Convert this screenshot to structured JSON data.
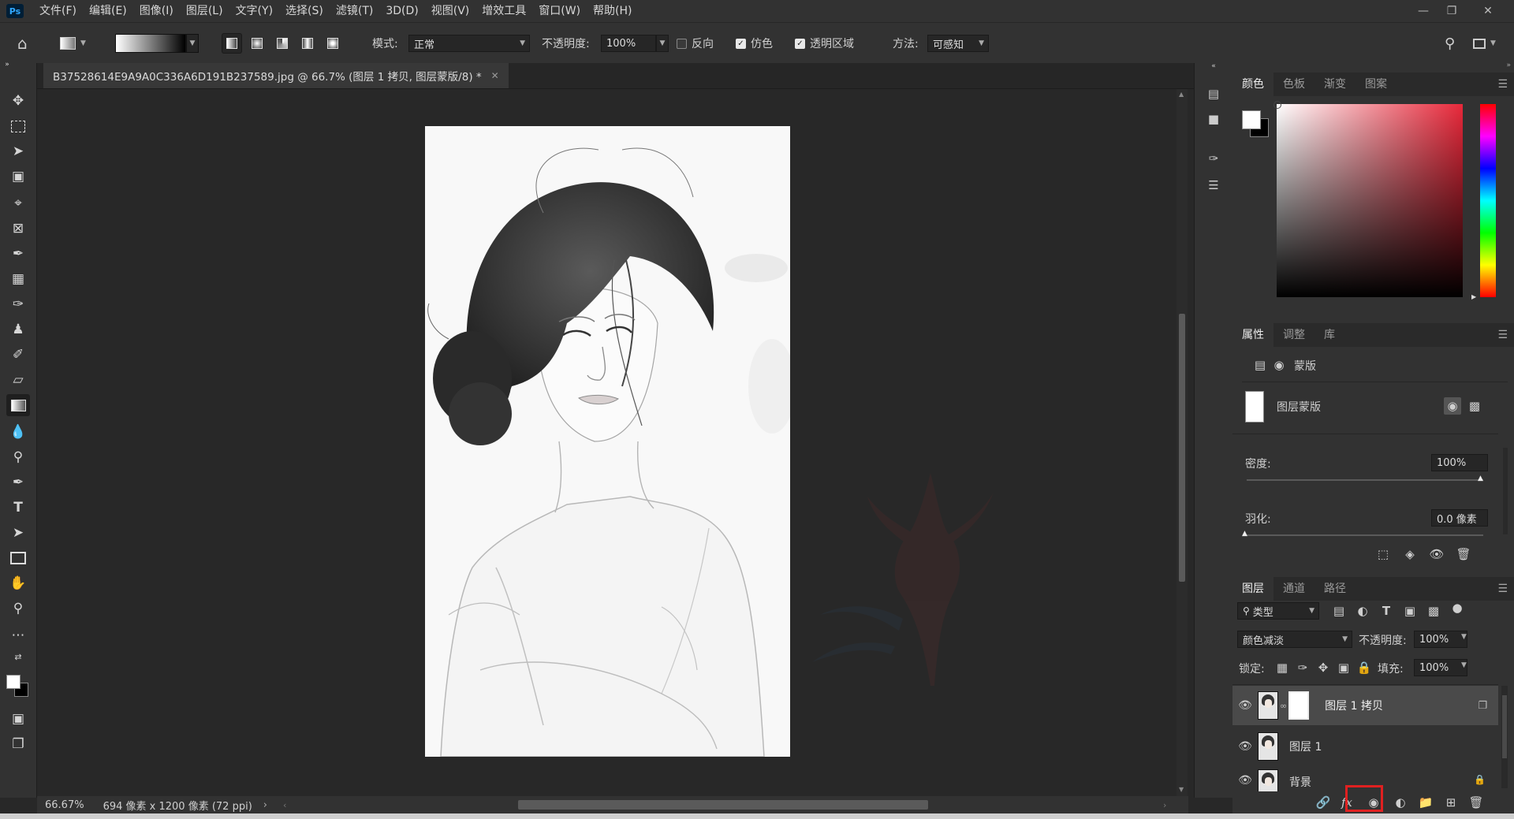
{
  "menubar": {
    "logo": "Ps",
    "items": [
      "文件(F)",
      "编辑(E)",
      "图像(I)",
      "图层(L)",
      "文字(Y)",
      "选择(S)",
      "滤镜(T)",
      "3D(D)",
      "视图(V)",
      "增效工具",
      "窗口(W)",
      "帮助(H)"
    ]
  },
  "options": {
    "mode_label": "模式:",
    "mode_value": "正常",
    "opacity_label": "不透明度:",
    "opacity_value": "100%",
    "reverse_label": "反向",
    "reverse_checked": false,
    "dither_label": "仿色",
    "dither_checked": true,
    "transparency_label": "透明区域",
    "transparency_checked": true,
    "method_label": "方法:",
    "method_value": "可感知"
  },
  "document": {
    "tab_title": "B37528614E9A9A0C336A6D191B237589.jpg @ 66.7% (图层 1 拷贝, 图层蒙版/8) *",
    "zoom": "66.67%",
    "size_info": "694 像素 x 1200 像素 (72 ppi)"
  },
  "color_panel": {
    "tabs": [
      "颜色",
      "色板",
      "渐变",
      "图案"
    ],
    "active_tab": "颜色",
    "hue_color": "#e8283a"
  },
  "properties_panel": {
    "tabs": [
      "属性",
      "调整",
      "库"
    ],
    "active_tab": "属性",
    "mask_section_label": "蒙版",
    "layer_mask_label": "图层蒙版",
    "density_label": "密度:",
    "density_value": "100%",
    "feather_label": "羽化:",
    "feather_value": "0.0 像素"
  },
  "layers_panel": {
    "tabs": [
      "图层",
      "通道",
      "路径"
    ],
    "active_tab": "图层",
    "filter_label": "类型",
    "blend_mode": "颜色减淡",
    "opacity_label": "不透明度:",
    "opacity_value": "100%",
    "lock_label": "锁定:",
    "fill_label": "填充:",
    "fill_value": "100%",
    "layers": [
      {
        "name": "图层 1 拷贝",
        "selected": true
      },
      {
        "name": "图层 1",
        "selected": false
      },
      {
        "name": "背景",
        "selected": false
      }
    ]
  }
}
